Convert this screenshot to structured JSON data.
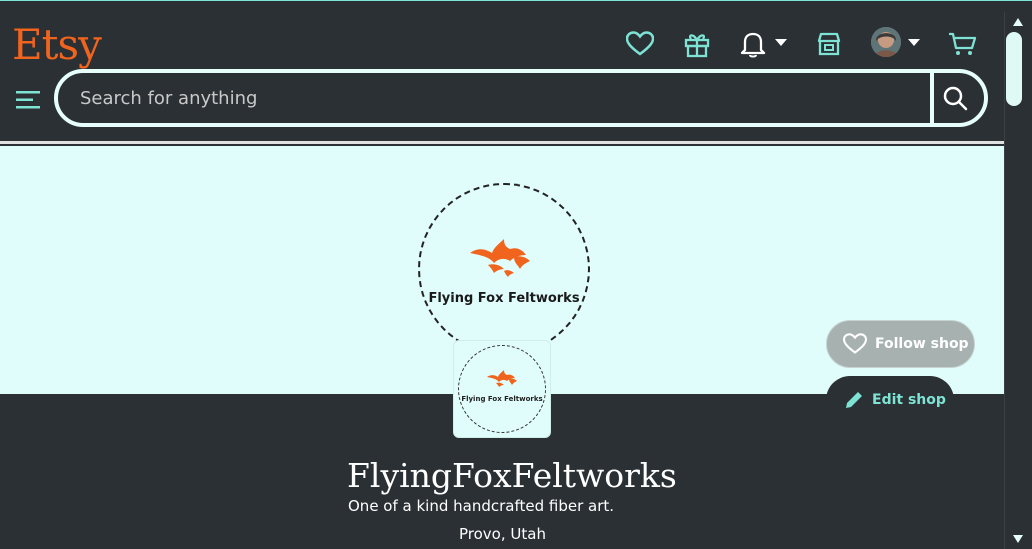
{
  "header": {
    "logo_text": "Etsy",
    "search": {
      "placeholder": "Search for anything"
    }
  },
  "banner": {
    "shop_logo_text": "Flying Fox Feltworks"
  },
  "shop": {
    "avatar_logo_text": "Flying Fox Feltworks",
    "name": "FlyingFoxFeltworks",
    "tagline": "One of a kind handcrafted fiber art.",
    "location": "Provo, Utah",
    "follow_label": "Follow shop",
    "edit_label": "Edit shop"
  },
  "icons": {
    "favorites": "heart-icon",
    "gifts": "gift-icon",
    "notifications": "bell-icon",
    "shop": "store-icon",
    "cart": "cart-icon",
    "menu": "hamburger-icon",
    "search": "search-icon"
  },
  "colors": {
    "brand": "#f1641e",
    "accent": "#7ee3d4",
    "background": "#2b3034",
    "banner": "#e0fdfb"
  }
}
